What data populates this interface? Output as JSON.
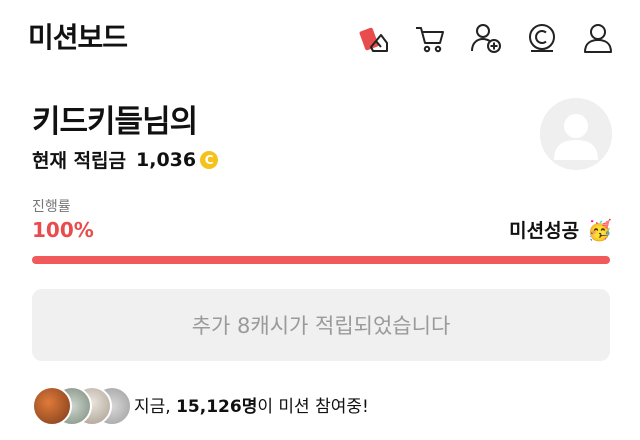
{
  "header": {
    "title": "미션보드",
    "icons": [
      "mission-card-icon",
      "cart-icon",
      "add-friend-icon",
      "cash-icon",
      "user-icon"
    ]
  },
  "profile": {
    "name": "키드키들님의",
    "points_label": "현재 적립금",
    "points_value": "1,036",
    "coin_symbol": "C"
  },
  "progress": {
    "label": "진행률",
    "percent_text": "100%",
    "percent": 100,
    "status": "미션성공",
    "fill_color": "#f05a5a"
  },
  "reward": {
    "message": "추가 8캐시가 적립되었습니다"
  },
  "participants": {
    "prefix": "지금, ",
    "count": "15,126명",
    "suffix": "이 미션 참여중!"
  }
}
